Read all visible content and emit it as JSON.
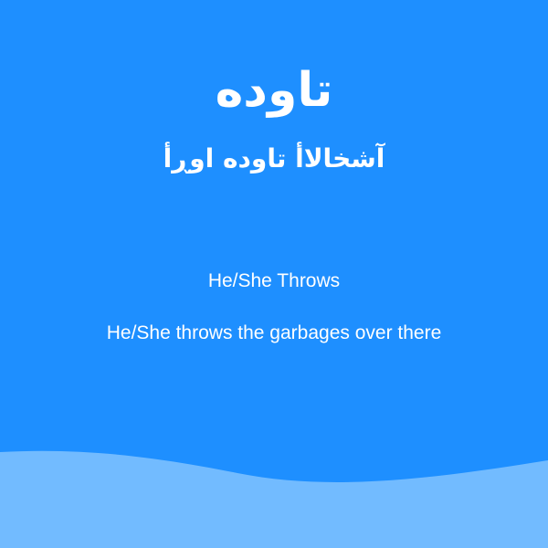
{
  "word": {
    "title": "تاوده",
    "subtitle": "آشخالاأ تاوده اوڕأ"
  },
  "meaning": {
    "translation": "He/She Throws",
    "example": "He/She throws the garbages over there"
  },
  "colors": {
    "background": "#1e8fff",
    "wave": "#72bbff",
    "text": "#ffffff"
  }
}
